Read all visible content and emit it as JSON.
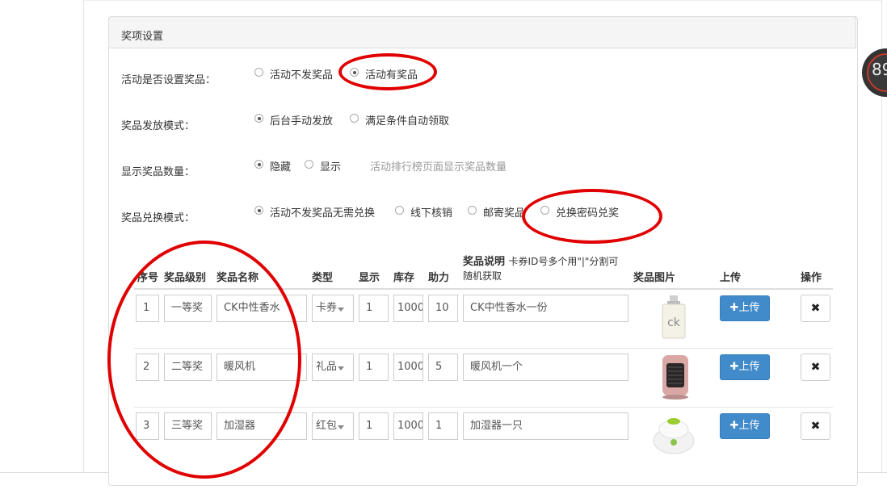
{
  "panel": {
    "title": "奖项设置"
  },
  "form": {
    "rows": [
      {
        "label": "活动是否设置奖品：",
        "options": [
          "活动不发奖品",
          "活动有奖品"
        ],
        "selected": 1,
        "hint": ""
      },
      {
        "label": "奖品发放模式：",
        "options": [
          "后台手动发放",
          "满足条件自动领取"
        ],
        "selected": 0,
        "hint": ""
      },
      {
        "label": "显示奖品数量：",
        "options": [
          "隐藏",
          "显示"
        ],
        "selected": 0,
        "hint": "活动排行榜页面显示奖品数量"
      },
      {
        "label": "奖品兑换模式：",
        "options": [
          "活动不发奖品无需兑换",
          "线下核销",
          "邮寄奖品",
          "兑换密码兑奖"
        ],
        "selected": 0,
        "hint": ""
      }
    ]
  },
  "table": {
    "headers": {
      "no": "序号",
      "level": "奖品级别",
      "name": "奖品名称",
      "type": "类型",
      "show": "显示",
      "stock": "库存",
      "assist": "助力",
      "desc": "奖品说明",
      "desc_note_1": "卡券ID号多个用\"|\"分割可",
      "desc_note_2": "随机获取",
      "image": "奖品图片",
      "upload": "上传",
      "action": "操作"
    },
    "rows": [
      {
        "no": "1",
        "level": "一等奖",
        "name": "CK中性香水",
        "type": "卡券",
        "show": "1",
        "stock": "1000",
        "assist": "10",
        "desc": "CK中性香水一份",
        "image": "perfume-image",
        "upload": "上传"
      },
      {
        "no": "2",
        "level": "二等奖",
        "name": "暖风机",
        "type": "礼品",
        "show": "1",
        "stock": "1000",
        "assist": "5",
        "desc": "暖风机一个",
        "image": "heater-image",
        "upload": "上传"
      },
      {
        "no": "3",
        "level": "三等奖",
        "name": "加湿器",
        "type": "红包",
        "show": "1",
        "stock": "1000",
        "assist": "1",
        "desc": "加湿器一只",
        "image": "humidifier-image",
        "upload": "上传"
      }
    ]
  },
  "badge": {
    "text": "89"
  },
  "colors": {
    "annotation_red": "#e00000",
    "upload_blue": "#428bca"
  }
}
